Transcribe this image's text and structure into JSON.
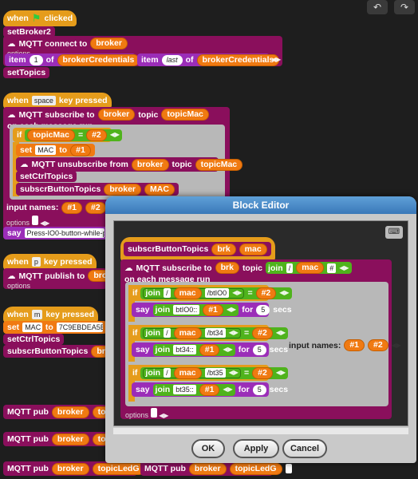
{
  "toolbar": {
    "undo_icon": "undo-arrow-icon"
  },
  "script1": {
    "hat_when": "when",
    "hat_clicked": "clicked",
    "setBroker": "setBroker2",
    "connect_label": "MQTT connect to",
    "broker": "broker",
    "options": "options",
    "item": "item",
    "item_index": "1",
    "of": "of",
    "brokerCredentials": "brokerCredentials",
    "item_last": "last",
    "setTopics": "setTopics"
  },
  "script2": {
    "when": "when",
    "key": "space",
    "key_pressed": "key pressed",
    "subscribe": "MQTT subscribe to",
    "broker": "broker",
    "topic": "topic",
    "topicMac": "topicMac",
    "on_each": "on each message run",
    "if": "if",
    "eq": "=",
    "hash2": "#2",
    "set": "set",
    "MAC": "MAC",
    "to": "to",
    "hash1": "#1",
    "unsubscribe": "MQTT unsubscribe from",
    "setCtrlTopics": "setCtrlTopics",
    "subscrButtonTopics": "subscrButtonTopics",
    "input_names": "input names:",
    "n1": "#1",
    "n2": "#2",
    "options": "options",
    "say": "say",
    "say_text": "Press-IO0-button-while-publis"
  },
  "script3": {
    "when": "when",
    "key": "p",
    "key_pressed": "key pressed",
    "publish": "MQTT publish to",
    "broker": "broke",
    "options": "options"
  },
  "script4": {
    "when": "when",
    "key": "m",
    "key_pressed": "key pressed",
    "set": "set",
    "MAC": "MAC",
    "to": "to",
    "mac_value": "7C9EBDEA5BA",
    "setCtrlTopics": "setCtrlTopics",
    "subscrButtonTopics": "subscrButtonTopics",
    "broker": "broke"
  },
  "pubs": {
    "pub": "MQTT pub",
    "broker": "broker",
    "topic": "topic",
    "topicLedG": "topicLedG"
  },
  "dialog": {
    "title": "Block Editor",
    "proto": "subscrButtonTopics",
    "brk": "brk",
    "mac": "mac",
    "subscribe": "MQTT subscribe to",
    "topic": "topic",
    "join": "join",
    "slash": "/",
    "hash": "#",
    "on_each": "on each message run",
    "if": "if",
    "eq": "=",
    "hash2": "#2",
    "hash1": "#1",
    "say": "say",
    "for": "for",
    "secs": "secs",
    "five": "5",
    "rows": [
      {
        "topic_str": "/btIO0",
        "say_str": "btIO0::"
      },
      {
        "topic_str": "/bt34",
        "say_str": "bt34::"
      },
      {
        "topic_str": "/bt35",
        "say_str": "bt35::"
      }
    ],
    "input_names": "input names:",
    "n1": "#1",
    "n2": "#2",
    "options": "options",
    "ok": "OK",
    "apply": "Apply",
    "cancel": "Cancel"
  }
}
